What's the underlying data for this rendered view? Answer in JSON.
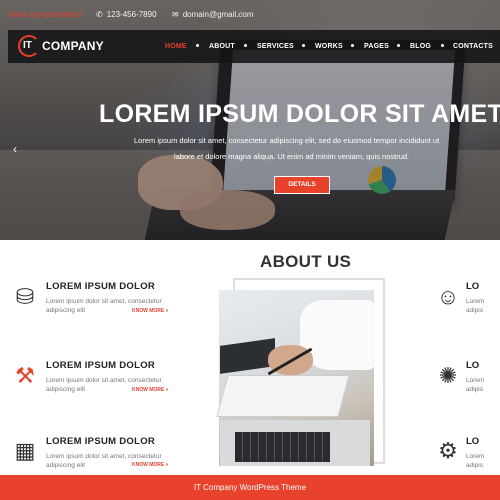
{
  "topbar": {
    "link": "Have any questions?",
    "phone": "123-456-7890",
    "email": "domain@gmail.com",
    "phone_icon": "phone-icon",
    "email_icon": "envelope-icon"
  },
  "logo": {
    "mark": "IT",
    "name": "COMPANY"
  },
  "nav": {
    "items": [
      "HOME",
      "ABOUT",
      "SERVICES",
      "WORKS",
      "PAGES",
      "BLOG",
      "CONTACTS"
    ],
    "active_color": "#e8412c"
  },
  "hero": {
    "title": "LOREM IPSUM DOLOR SIT AMET",
    "subtitle_line1": "Lorem ipsum dolor sit amet, consectetur adipiscing elit, sed do eiusmod tempor incididunt ut",
    "subtitle_line2": "labore et dolore magna aliqua. Ut enim ad minim veniam, quis nostrud.",
    "button": "DETAILS",
    "prev_arrow": "‹"
  },
  "about": {
    "title": "ABOUT US"
  },
  "features_left": [
    {
      "title": "LOREM IPSUM DOLOR",
      "text_line1": "Lorem ipsum dolor sit amet, consectetur",
      "text_line2": "adipiscing elit",
      "more": "KNOW MORE »",
      "icon": "wallet-icon"
    },
    {
      "title": "LOREM IPSUM DOLOR",
      "text_line1": "Lorem ipsum dolor sit amet, consectetur",
      "text_line2": "adipiscing elit",
      "more": "KNOW MORE »",
      "icon": "engineer-icon"
    },
    {
      "title": "LOREM IPSUM DOLOR",
      "text_line1": "Lorem ipsum dolor sit amet, consectetur",
      "text_line2": "adipiscing elit",
      "more": "KNOW MORE »",
      "icon": "qr-code-icon"
    }
  ],
  "features_right": [
    {
      "title": "LO",
      "text_line1": "Lorem",
      "text_line2": "adipis",
      "icon": "support-agent-icon"
    },
    {
      "title": "LO",
      "text_line1": "Lorem",
      "text_line2": "adipis",
      "icon": "idea-icon"
    },
    {
      "title": "LO",
      "text_line1": "Lorem",
      "text_line2": "adipis",
      "icon": "settings-hand-icon"
    }
  ],
  "footer": {
    "text": "IT Company WordPress Theme"
  },
  "colors": {
    "accent": "#e8412c",
    "nav_bg": "#141418",
    "text_dark": "#222222",
    "text_muted": "#777777"
  }
}
